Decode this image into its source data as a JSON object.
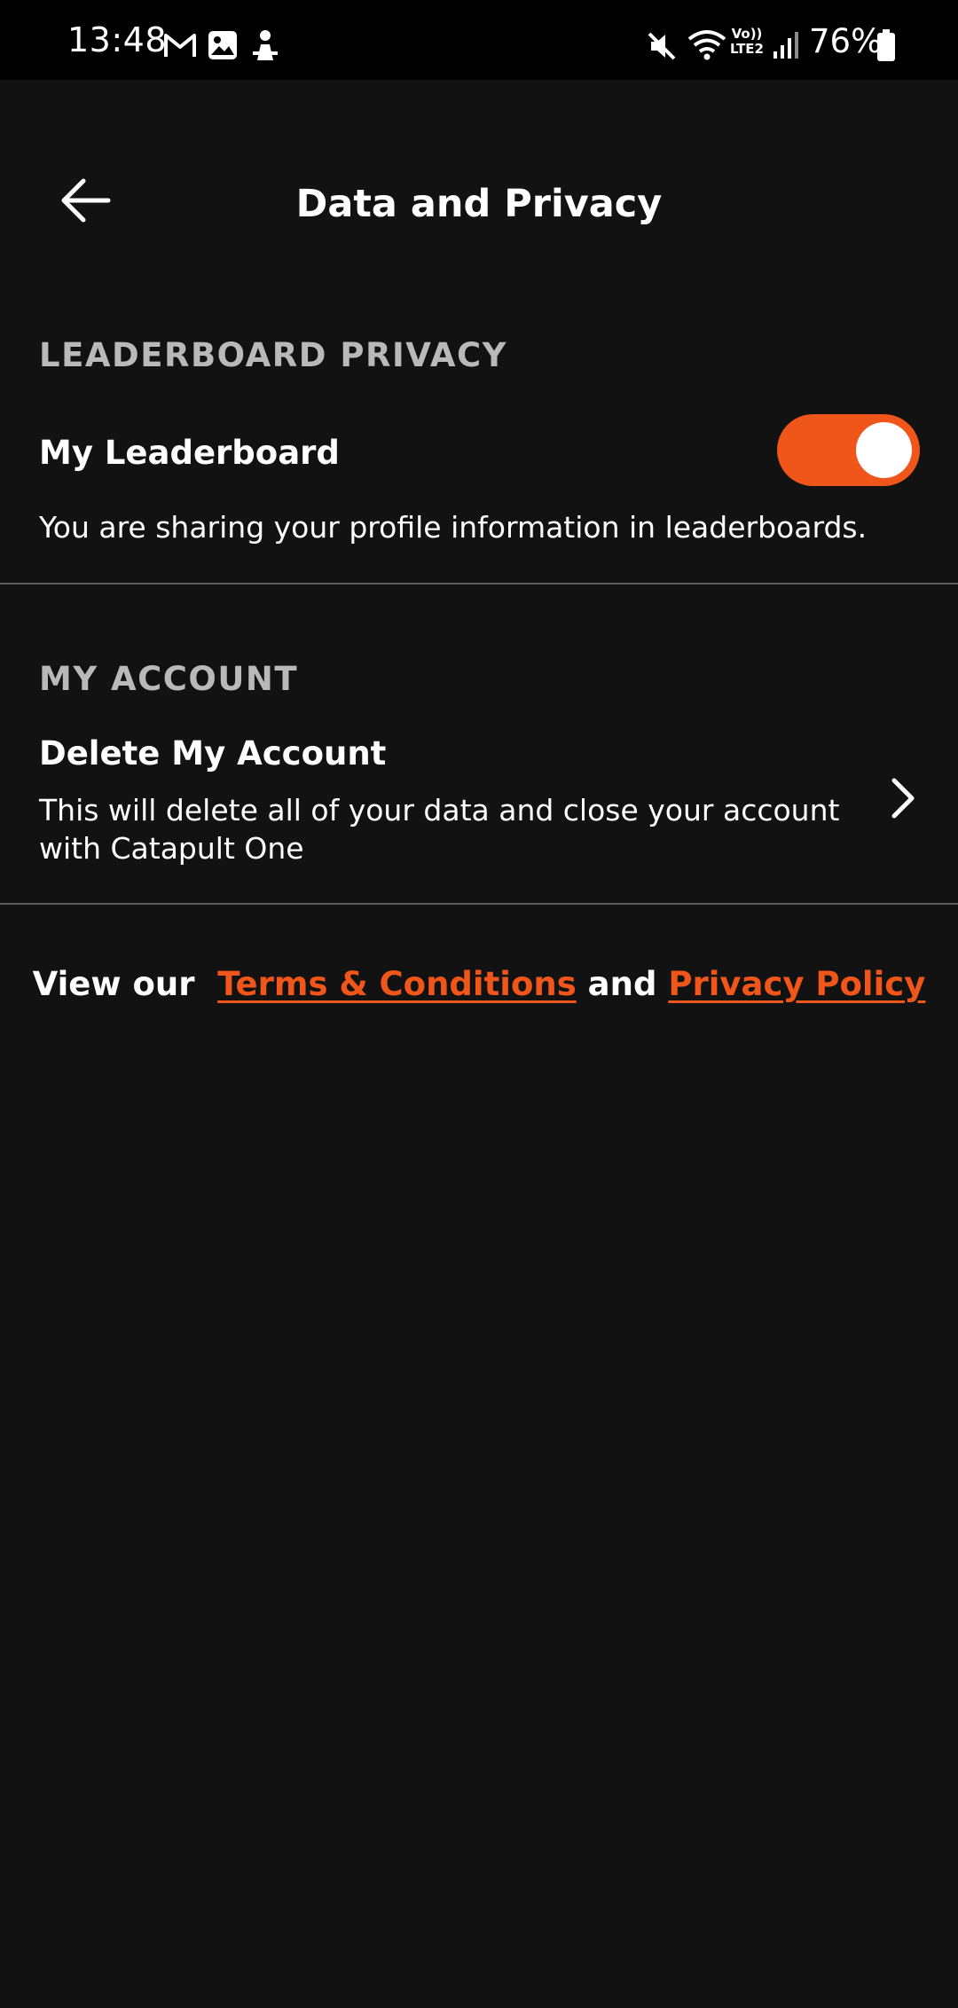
{
  "status_bar": {
    "time": "13:48",
    "notification_icons": [
      "gmail-icon",
      "gallery-icon",
      "app-notification-icon"
    ],
    "system_icons": [
      "mute-icon",
      "wifi-icon",
      "volte-lte2-icon",
      "signal-icon",
      "battery-icon"
    ],
    "volte_label_top": "Vo))",
    "volte_label_bottom": "LTE2",
    "battery_percent": "76%"
  },
  "header": {
    "back_icon": "arrow-left-icon",
    "title": "Data and Privacy"
  },
  "leaderboard_section": {
    "heading": "LEADERBOARD PRIVACY",
    "item_title": "My Leaderboard",
    "toggle_on": true,
    "description": "You are sharing your profile information in leaderboards."
  },
  "account_section": {
    "heading": "MY ACCOUNT",
    "item_title": "Delete My Account",
    "description_line1": "This will delete all of your data and close your account",
    "description_line2": "with Catapult One",
    "chevron_icon": "chevron-right-icon"
  },
  "footer": {
    "prefix": "View our",
    "terms_link": "Terms & Conditions",
    "conjunction": "and",
    "privacy_link": "Privacy Policy"
  },
  "colors": {
    "background": "#121212",
    "status_bar": "#000000",
    "accent": "#f0561a",
    "heading": "#b9b9b9",
    "divider": "#5c5c5c",
    "text": "#ffffff"
  }
}
